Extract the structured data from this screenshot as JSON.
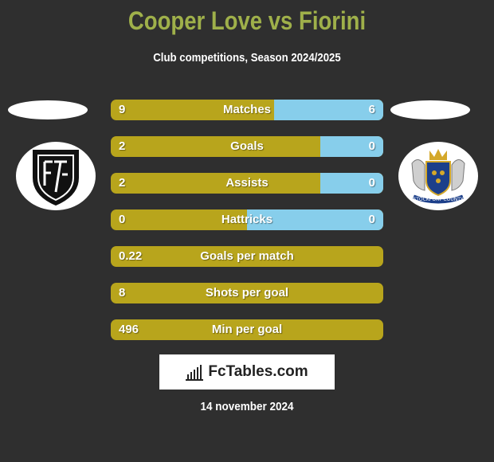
{
  "header": {
    "title": "Cooper Love vs Fiorini",
    "subtitle": "Club competitions, Season 2024/2025"
  },
  "teams": {
    "left": {
      "logo_icon": "academica-crest-icon",
      "logo_letters": "AF"
    },
    "right": {
      "logo_icon": "stockport-county-crest-icon",
      "logo_text": "STOCKPORT COUNTY"
    }
  },
  "colors": {
    "background": "#2f2f2f",
    "title": "#9fb04a",
    "left_bar": "#b8a51c",
    "right_bar": "#87ceeb"
  },
  "stats": [
    {
      "label": "Matches",
      "left": "9",
      "right": "6",
      "right_share": 0.4
    },
    {
      "label": "Goals",
      "left": "2",
      "right": "0",
      "right_share": 0.23
    },
    {
      "label": "Assists",
      "left": "2",
      "right": "0",
      "right_share": 0.23
    },
    {
      "label": "Hattricks",
      "left": "0",
      "right": "0",
      "right_share": 0.5
    },
    {
      "label": "Goals per match",
      "left": "0.22",
      "right": "",
      "right_share": 0
    },
    {
      "label": "Shots per goal",
      "left": "8",
      "right": "",
      "right_share": 0
    },
    {
      "label": "Min per goal",
      "left": "496",
      "right": "",
      "right_share": 0
    }
  ],
  "brand": {
    "name": "FcTables.com",
    "icon": "bar-chart-icon"
  },
  "footer": {
    "date": "14 november 2024"
  }
}
